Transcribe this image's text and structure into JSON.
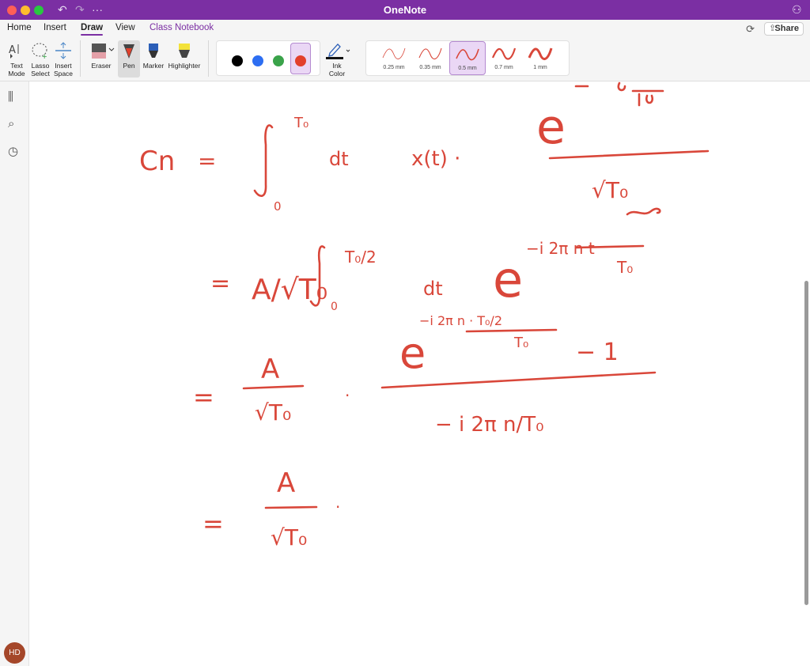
{
  "window": {
    "title": "OneNote"
  },
  "tabs": [
    {
      "label": "Home"
    },
    {
      "label": "Insert"
    },
    {
      "label": "Draw"
    },
    {
      "label": "View"
    },
    {
      "label": "Class Notebook"
    }
  ],
  "share_label": "Share",
  "tools": {
    "text_mode": "Text\nMode",
    "lasso_select": "Lasso\nSelect",
    "insert_space": "Insert\nSpace",
    "eraser": "Eraser",
    "pen": "Pen",
    "marker": "Marker",
    "highlighter": "Highlighter",
    "ink_color": "Ink\nColor"
  },
  "colors": [
    "#000000",
    "#2d6ef2",
    "#3aa34a",
    "#e2402c"
  ],
  "selected_color": "#e2402c",
  "thickness": [
    {
      "label": "0.25 mm"
    },
    {
      "label": "0.35 mm"
    },
    {
      "label": "0.5 mm"
    },
    {
      "label": "0.7 mm"
    },
    {
      "label": "1 mm"
    }
  ],
  "selected_thickness": "0.5 mm",
  "user": {
    "initials": "HD"
  },
  "ink": {
    "line1": {
      "lhs": "Cn",
      "eq": "=",
      "upper": "T₀",
      "lower": "0",
      "dt": "dt",
      "fx": "x(t) ·",
      "num": "e",
      "den": "√T₀"
    },
    "line2": {
      "eq": "=",
      "coef": "A/√T₀",
      "upper": "T₀/2",
      "lower": "0",
      "dt": "dt",
      "base": "e",
      "exp": "−i 2π n t",
      "exp_den": "T₀"
    },
    "line3": {
      "eq": "=",
      "num": "A",
      "den": "√T₀",
      "dot": "·",
      "frac_num": "e",
      "frac_exp": "−i 2π n · T₀/2",
      "frac_exp_den": "T₀",
      "minus_one": "− 1",
      "frac_den": "− i   2π n/T₀"
    },
    "line4": {
      "eq": "=",
      "num": "A",
      "den": "√T₀",
      "dot": "·"
    }
  }
}
